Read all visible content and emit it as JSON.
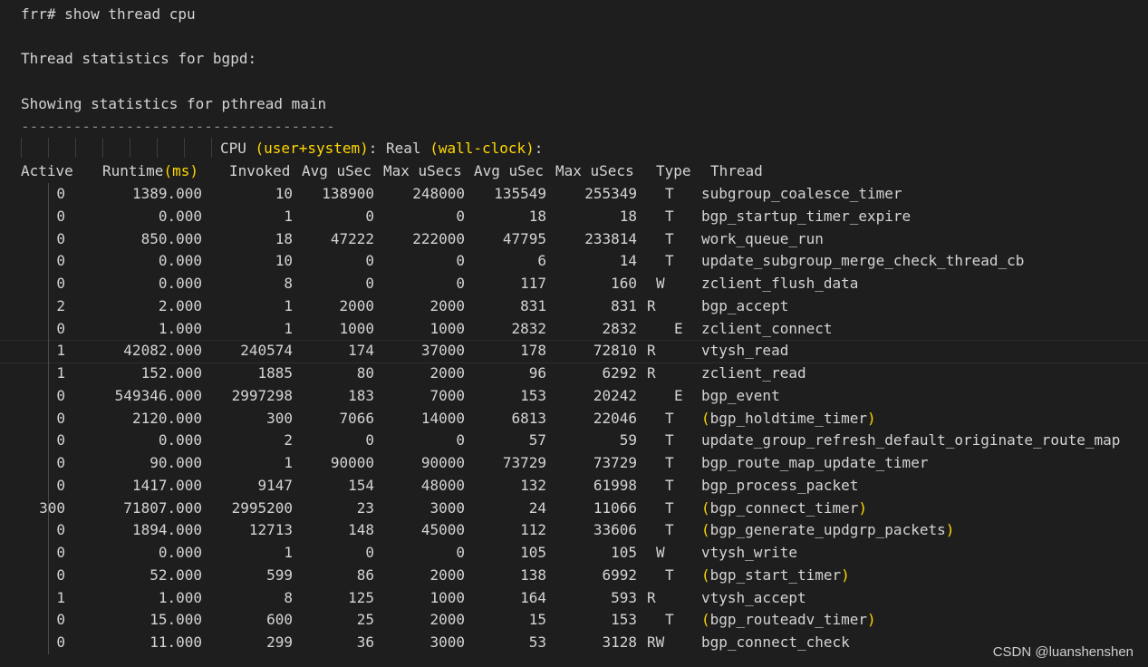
{
  "terminal": {
    "command": "frr# show thread cpu",
    "stats_title": "Thread statistics for bgpd:",
    "pthread_title": "Showing statistics for pthread main",
    "divider": "------------------------------------",
    "cpu_label": "CPU ",
    "cpu_paren": "(user+system)",
    "real_label": ": Real ",
    "real_paren": "(wall-clock)",
    "real_end": ":"
  },
  "table": {
    "headers": {
      "active": "Active",
      "runtime": "Runtime",
      "runtime_unit": "(ms)",
      "invoked": "Invoked",
      "avg1": "Avg uSec",
      "max1": "Max uSecs",
      "avg2": "Avg uSec",
      "max2": "Max uSecs",
      "type": "Type",
      "thread": "Thread"
    },
    "rows": [
      {
        "active": "0",
        "runtime": "1389.000",
        "invoked": "10",
        "avg1": "138900",
        "max1": "248000",
        "avg2": "135549",
        "max2": "255349",
        "type": "T",
        "type_pos": "t",
        "thread": "subgroup_coalesce_timer",
        "paren": false
      },
      {
        "active": "0",
        "runtime": "0.000",
        "invoked": "1",
        "avg1": "0",
        "max1": "0",
        "avg2": "18",
        "max2": "18",
        "type": "T",
        "type_pos": "t",
        "thread": "bgp_startup_timer_expire",
        "paren": false
      },
      {
        "active": "0",
        "runtime": "850.000",
        "invoked": "18",
        "avg1": "47222",
        "max1": "222000",
        "avg2": "47795",
        "max2": "233814",
        "type": "T",
        "type_pos": "t",
        "thread": "work_queue_run",
        "paren": false
      },
      {
        "active": "0",
        "runtime": "0.000",
        "invoked": "10",
        "avg1": "0",
        "max1": "0",
        "avg2": "6",
        "max2": "14",
        "type": "T",
        "type_pos": "t",
        "thread": "update_subgroup_merge_check_thread_cb",
        "paren": false
      },
      {
        "active": "0",
        "runtime": "0.000",
        "invoked": "8",
        "avg1": "0",
        "max1": "0",
        "avg2": "117",
        "max2": "160",
        "type": "W",
        "type_pos": "w",
        "thread": "zclient_flush_data",
        "paren": false
      },
      {
        "active": "2",
        "runtime": "2.000",
        "invoked": "1",
        "avg1": "2000",
        "max1": "2000",
        "avg2": "831",
        "max2": "831",
        "type": "R",
        "type_pos": "r",
        "thread": "bgp_accept",
        "paren": false
      },
      {
        "active": "0",
        "runtime": "1.000",
        "invoked": "1",
        "avg1": "1000",
        "max1": "1000",
        "avg2": "2832",
        "max2": "2832",
        "type": "E",
        "type_pos": "e",
        "thread": "zclient_connect",
        "paren": false
      },
      {
        "active": "1",
        "runtime": "42082.000",
        "invoked": "240574",
        "avg1": "174",
        "max1": "37000",
        "avg2": "178",
        "max2": "72810",
        "type": "R",
        "type_pos": "r",
        "thread": "vtysh_read",
        "paren": false
      },
      {
        "active": "1",
        "runtime": "152.000",
        "invoked": "1885",
        "avg1": "80",
        "max1": "2000",
        "avg2": "96",
        "max2": "6292",
        "type": "R",
        "type_pos": "r",
        "thread": "zclient_read",
        "paren": false
      },
      {
        "active": "0",
        "runtime": "549346.000",
        "invoked": "2997298",
        "avg1": "183",
        "max1": "7000",
        "avg2": "153",
        "max2": "20242",
        "type": "E",
        "type_pos": "e",
        "thread": "bgp_event",
        "paren": false
      },
      {
        "active": "0",
        "runtime": "2120.000",
        "invoked": "300",
        "avg1": "7066",
        "max1": "14000",
        "avg2": "6813",
        "max2": "22046",
        "type": "T",
        "type_pos": "t",
        "thread": "bgp_holdtime_timer",
        "paren": true
      },
      {
        "active": "0",
        "runtime": "0.000",
        "invoked": "2",
        "avg1": "0",
        "max1": "0",
        "avg2": "57",
        "max2": "59",
        "type": "T",
        "type_pos": "t",
        "thread": "update_group_refresh_default_originate_route_map",
        "paren": false
      },
      {
        "active": "0",
        "runtime": "90.000",
        "invoked": "1",
        "avg1": "90000",
        "max1": "90000",
        "avg2": "73729",
        "max2": "73729",
        "type": "T",
        "type_pos": "t",
        "thread": "bgp_route_map_update_timer",
        "paren": false
      },
      {
        "active": "0",
        "runtime": "1417.000",
        "invoked": "9147",
        "avg1": "154",
        "max1": "48000",
        "avg2": "132",
        "max2": "61998",
        "type": "T",
        "type_pos": "t",
        "thread": "bgp_process_packet",
        "paren": false
      },
      {
        "active": "300",
        "runtime": "71807.000",
        "invoked": "2995200",
        "avg1": "23",
        "max1": "3000",
        "avg2": "24",
        "max2": "11066",
        "type": "T",
        "type_pos": "t",
        "thread": "bgp_connect_timer",
        "paren": true
      },
      {
        "active": "0",
        "runtime": "1894.000",
        "invoked": "12713",
        "avg1": "148",
        "max1": "45000",
        "avg2": "112",
        "max2": "33606",
        "type": "T",
        "type_pos": "t",
        "thread": "bgp_generate_updgrp_packets",
        "paren": true
      },
      {
        "active": "0",
        "runtime": "0.000",
        "invoked": "1",
        "avg1": "0",
        "max1": "0",
        "avg2": "105",
        "max2": "105",
        "type": "W",
        "type_pos": "w",
        "thread": "vtysh_write",
        "paren": false
      },
      {
        "active": "0",
        "runtime": "52.000",
        "invoked": "599",
        "avg1": "86",
        "max1": "2000",
        "avg2": "138",
        "max2": "6992",
        "type": "T",
        "type_pos": "t",
        "thread": "bgp_start_timer",
        "paren": true
      },
      {
        "active": "1",
        "runtime": "1.000",
        "invoked": "8",
        "avg1": "125",
        "max1": "1000",
        "avg2": "164",
        "max2": "593",
        "type": "R",
        "type_pos": "r",
        "thread": "vtysh_accept",
        "paren": false
      },
      {
        "active": "0",
        "runtime": "15.000",
        "invoked": "600",
        "avg1": "25",
        "max1": "2000",
        "avg2": "15",
        "max2": "153",
        "type": "T",
        "type_pos": "t",
        "thread": "bgp_routeadv_timer",
        "paren": true
      },
      {
        "active": "0",
        "runtime": "11.000",
        "invoked": "299",
        "avg1": "36",
        "max1": "3000",
        "avg2": "53",
        "max2": "3128",
        "type": "RW",
        "type_pos": "r",
        "thread": "bgp_connect_check",
        "paren": false
      }
    ]
  },
  "watermark": "CSDN @luanshenshen",
  "colors": {
    "background": "#1e1e1e",
    "text": "#d4d4d4",
    "paren": "#ffd700"
  }
}
